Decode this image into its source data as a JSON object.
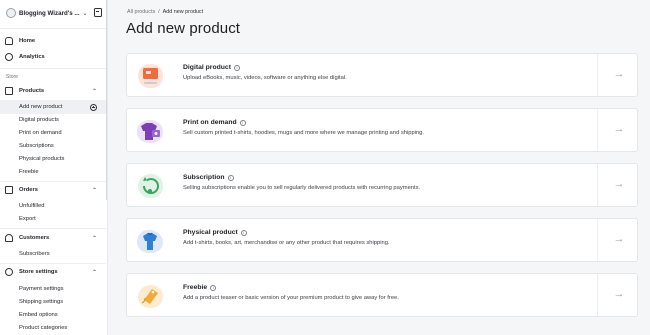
{
  "account": {
    "name": "Blogging Wizard's ...",
    "chevron": "⌄"
  },
  "nav": {
    "home": "Home",
    "analytics": "Analytics",
    "store_section": "Store",
    "products": {
      "label": "Products",
      "items": [
        "Add new product",
        "Digital products",
        "Print on demand",
        "Subscriptions",
        "Physical products",
        "Freebie"
      ]
    },
    "orders": {
      "label": "Orders",
      "items": [
        "Unfulfilled",
        "Export"
      ]
    },
    "customers": {
      "label": "Customers",
      "items": [
        "Subscribers"
      ]
    },
    "store_settings": {
      "label": "Store settings",
      "items": [
        "Payment settings",
        "Shipping settings",
        "Embed options",
        "Product categories"
      ]
    }
  },
  "breadcrumb": {
    "root": "All products",
    "separator": "/",
    "current": "Add new product"
  },
  "page_title": "Add new product",
  "product_types": [
    {
      "title": "Digital product",
      "description": "Upload eBooks, music, videos, software or anything else digital.",
      "accent": "#f26b3a",
      "icon": "digital-product-icon"
    },
    {
      "title": "Print on demand",
      "description": "Sell custom printed t-shirts, hoodies, mugs and more where we manage printing and shipping.",
      "accent": "#7b3fb8",
      "icon": "print-on-demand-icon"
    },
    {
      "title": "Subscription",
      "description": "Selling subscriptions enable you to sell regularly delivered products with recurring payments.",
      "accent": "#3aa55d",
      "icon": "subscription-icon"
    },
    {
      "title": "Physical product",
      "description": "Add t-shirts, books, art, merchandise or any other product that requires shipping.",
      "accent": "#2f7fd6",
      "icon": "physical-product-icon"
    },
    {
      "title": "Freebie",
      "description": "Add a product teaser or basic version of your premium product to give away for free.",
      "accent": "#f2a93a",
      "icon": "freebie-icon"
    }
  ],
  "arrow_glyph": "→"
}
